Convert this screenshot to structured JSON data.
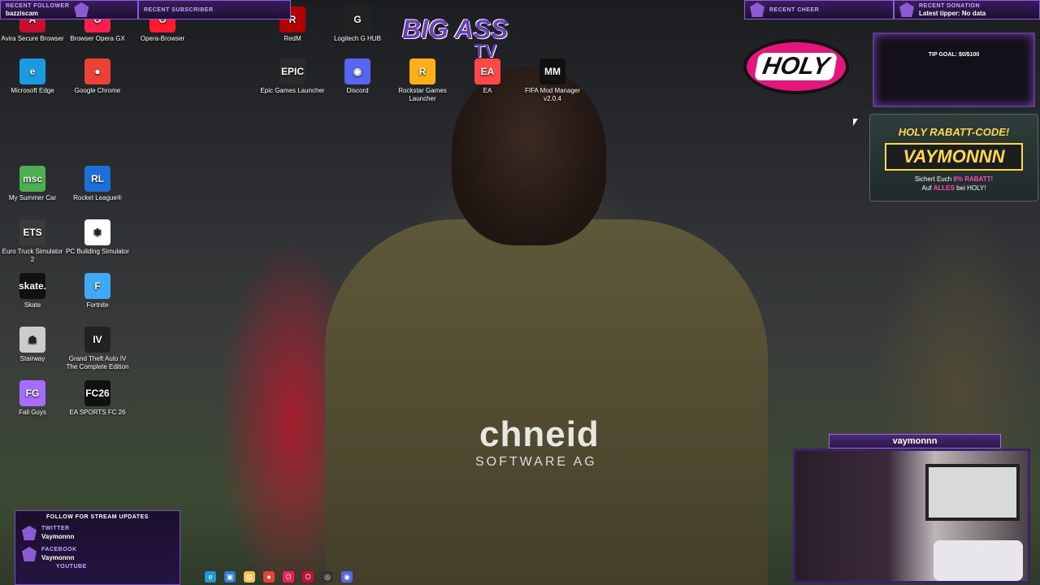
{
  "desktop_icons": [
    {
      "label": "Avira Secure Browser",
      "color": "#c8102e",
      "glyph": "A"
    },
    {
      "label": "Browser Opera GX",
      "color": "#fa1e4e",
      "glyph": "O"
    },
    {
      "label": "Opera-Browser",
      "color": "#ff1b2d",
      "glyph": "O"
    },
    {
      "label": "RedM",
      "color": "#b30000",
      "glyph": "R"
    },
    {
      "label": "Logitech G HUB",
      "color": "#222222",
      "glyph": "G"
    },
    {
      "label": "Microsoft Edge",
      "color": "#1b9ae0",
      "glyph": "e"
    },
    {
      "label": "Google Chrome",
      "color": "#ea4335",
      "glyph": "●"
    },
    {
      "label": "Epic Games Launcher",
      "color": "#2a2a2a",
      "glyph": "EPIC"
    },
    {
      "label": "Discord",
      "color": "#5865f2",
      "glyph": "◉"
    },
    {
      "label": "Rockstar Games Launcher",
      "color": "#fcaf17",
      "glyph": "R"
    },
    {
      "label": "EA",
      "color": "#ff4747",
      "glyph": "EA"
    },
    {
      "label": "FIFA Mod Manager v2.0.4",
      "color": "#111111",
      "glyph": "MM"
    },
    {
      "label": "My Summer Car",
      "color": "#4caf50",
      "glyph": "msc"
    },
    {
      "label": "Rocket League®",
      "color": "#1e6fd9",
      "glyph": "RL"
    },
    {
      "label": "Euro Truck Simulator 2",
      "color": "#3a3a3a",
      "glyph": "ETS"
    },
    {
      "label": "PC Building Simulator",
      "color": "#ffffff",
      "glyph": "✱"
    },
    {
      "label": "Skate",
      "color": "#111111",
      "glyph": "skate."
    },
    {
      "label": "Fortnite",
      "color": "#3fa9f5",
      "glyph": "F"
    },
    {
      "label": "Stairway",
      "color": "#cccccc",
      "glyph": "☗"
    },
    {
      "label": "Grand Theft Auto IV The Complete Edition",
      "color": "#222222",
      "glyph": "IV"
    },
    {
      "label": "Fall Guys",
      "color": "#a66cff",
      "glyph": "FG"
    },
    {
      "label": "EA SPORTS FC 26",
      "color": "#111111",
      "glyph": "FC26"
    }
  ],
  "overlay": {
    "recent_follower_label": "RECENT FOLLOWER",
    "recent_follower_value": "bazziscam",
    "recent_subscriber_label": "RECENT SUBSCRIBER",
    "recent_cheer_label": "RECENT CHEER",
    "recent_donation_label": "RECENT DONATION",
    "recent_donation_value": "Latest tipper: No data",
    "tip_goal": "TIP GOAL: $0/$100",
    "stream_logo": "BIG ASS",
    "stream_logo_sub": "TV",
    "holy_logo": "HOLY",
    "promo_title": "HOLY RABATT-CODE!",
    "promo_code": "VAYMONNN",
    "promo_line1_a": "Sichert Euch ",
    "promo_line1_hl": "8% RABATT!",
    "promo_line2_a": "Auf ",
    "promo_line2_hl": "ALLES",
    "promo_line2_b": " bei HOLY!",
    "webcam_name": "vaymonnn",
    "follow_header": "FOLLOW FOR STREAM UPDATES",
    "follow": [
      {
        "network": "TWITTER",
        "handle": "Vaymonnn"
      },
      {
        "network": "FACEBOOK",
        "handle": "Vaymonnn"
      },
      {
        "network": "YOUTUBE",
        "handle": ""
      }
    ]
  },
  "wallpaper": {
    "jersey_text": "chneid",
    "jersey_sub": "SOFTWARE AG"
  },
  "taskbar_icons": [
    {
      "name": "edge-taskbar-icon",
      "color": "#1b9ae0",
      "glyph": "e"
    },
    {
      "name": "store-taskbar-icon",
      "color": "#2d7dd2",
      "glyph": "▣"
    },
    {
      "name": "explorer-taskbar-icon",
      "color": "#f3c04e",
      "glyph": "▤"
    },
    {
      "name": "chrome-taskbar-icon",
      "color": "#ea4335",
      "glyph": "●"
    },
    {
      "name": "opera-gx-taskbar-icon",
      "color": "#fa1e4e",
      "glyph": "O"
    },
    {
      "name": "opera-taskbar-icon",
      "color": "#c8102e",
      "glyph": "O"
    },
    {
      "name": "obs-taskbar-icon",
      "color": "#333333",
      "glyph": "◎"
    },
    {
      "name": "discord-taskbar-icon",
      "color": "#5865f2",
      "glyph": "◉"
    }
  ]
}
